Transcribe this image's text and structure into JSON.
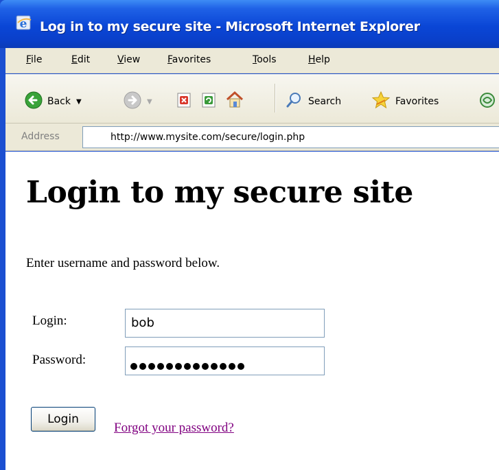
{
  "window": {
    "title": "Log in to my secure site - Microsoft Internet Explorer"
  },
  "menu": {
    "items": [
      "File",
      "Edit",
      "View",
      "Favorites",
      "Tools",
      "Help"
    ]
  },
  "toolbar": {
    "back_label": "Back",
    "search_label": "Search",
    "favorites_label": "Favorites"
  },
  "address": {
    "label": "Address",
    "url": "http://www.mysite.com/secure/login.php"
  },
  "page": {
    "title": "Login to my secure site",
    "intro": "Enter username and password below.",
    "login_label": "Login:",
    "login_value": "bob",
    "password_label": "Password:",
    "password_masked_count": 13,
    "login_button_label": "Login",
    "forgot_link_text": "Forgot your password?"
  },
  "colors": {
    "titlebar_blue": "#0a46d6",
    "chrome": "#ece9d8",
    "visited_link": "#800080",
    "input_border": "#7f9db9"
  },
  "icons": [
    "ie-logo-icon",
    "back-arrow-icon",
    "forward-arrow-icon",
    "stop-icon",
    "refresh-icon",
    "home-icon",
    "search-icon",
    "favorites-star-icon",
    "media-icon"
  ]
}
